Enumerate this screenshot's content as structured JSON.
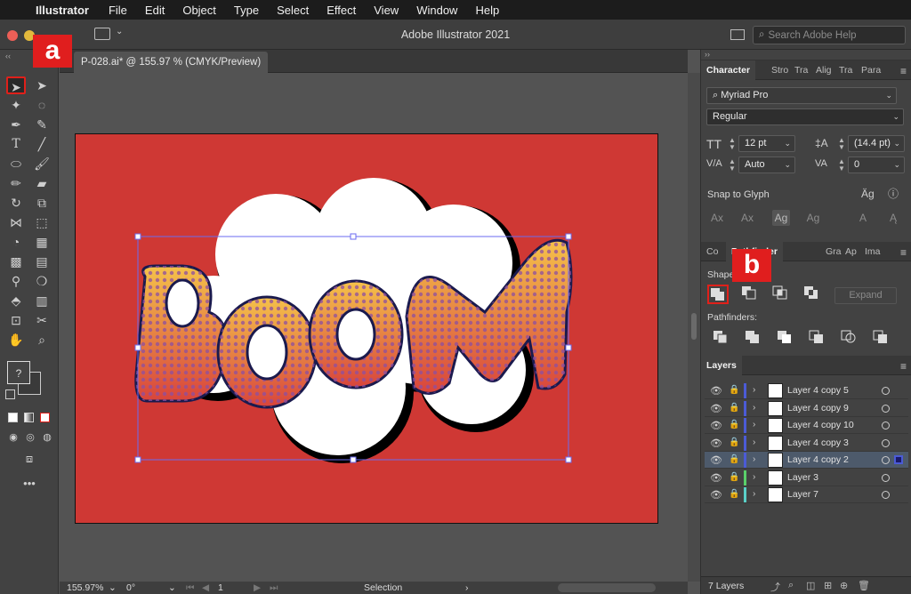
{
  "menubar": {
    "apple": "",
    "items": [
      "Illustrator",
      "File",
      "Edit",
      "Object",
      "Type",
      "Select",
      "Effect",
      "View",
      "Window",
      "Help"
    ]
  },
  "titlebar": {
    "title": "Adobe Illustrator 2021",
    "search_placeholder": "Search Adobe Help"
  },
  "document": {
    "tab_label": "P-028.ai* @ 155.97 % (CMYK/Preview)"
  },
  "statusbar": {
    "zoom": "155.97%",
    "rotation": "0°",
    "artboard": "1",
    "tool": "Selection"
  },
  "character_panel": {
    "tabs": [
      "Character",
      "Stro",
      "Tra",
      "Alig",
      "Tra",
      "Para"
    ],
    "font_family": "Myriad Pro",
    "font_style": "Regular",
    "font_size": "12 pt",
    "leading": "(14.4 pt)",
    "kerning": "Auto",
    "tracking": "0",
    "snap_label": "Snap to Glyph"
  },
  "pathfinder_panel": {
    "tabs": [
      "Co",
      "Pathfinder",
      "Gra",
      "Ap",
      "Ima"
    ],
    "shape_modes_label": "Shape",
    "pathfinders_label": "Pathfinders:",
    "expand_label": "Expand"
  },
  "layers_panel": {
    "title": "Layers",
    "layers": [
      {
        "name": "Layer 4 copy 5",
        "color": "#4b5bd6",
        "selected": false
      },
      {
        "name": "Layer 4 copy 9",
        "color": "#4b5bd6",
        "selected": false
      },
      {
        "name": "Layer 4 copy 10",
        "color": "#4b5bd6",
        "selected": false
      },
      {
        "name": "Layer 4 copy 3",
        "color": "#4b5bd6",
        "selected": false
      },
      {
        "name": "Layer 4 copy 2",
        "color": "#4b5bd6",
        "selected": true
      },
      {
        "name": "Layer 3",
        "color": "#5ad06a",
        "selected": false
      },
      {
        "name": "Layer 7",
        "color": "#5ad0c8",
        "selected": false
      }
    ],
    "count_label": "7 Layers"
  },
  "artwork": {
    "word": "BOOM",
    "background_color": "#cf3834",
    "cloud_color": "#ffffff",
    "text_gradient_top": "#f5c24a",
    "text_gradient_bottom": "#d8443c",
    "outline_color": "#1a1a4e"
  },
  "markers": {
    "a": "a",
    "b": "b"
  }
}
